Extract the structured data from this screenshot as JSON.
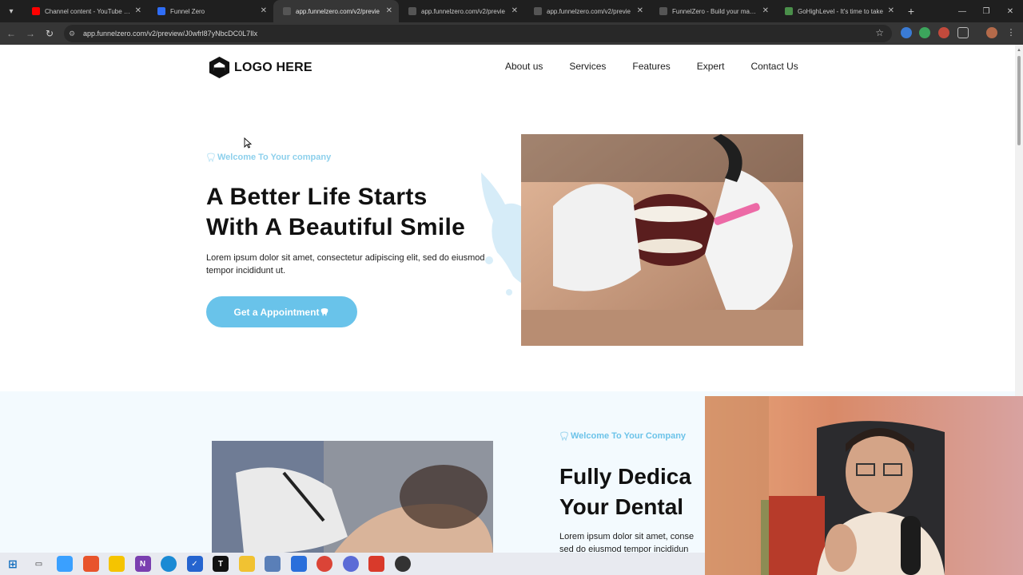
{
  "browser": {
    "tabs": [
      {
        "label": "Channel content - YouTube Stu",
        "favicon_color": "#ff0000"
      },
      {
        "label": "Funnel Zero",
        "favicon_color": "#2f6df6"
      },
      {
        "label": "app.funnelzero.com/v2/previe",
        "favicon_color": "#555555"
      },
      {
        "label": "app.funnelzero.com/v2/previe",
        "favicon_color": "#555555"
      },
      {
        "label": "app.funnelzero.com/v2/previe",
        "favicon_color": "#555555"
      },
      {
        "label": "FunnelZero - Build your marke",
        "favicon_color": "#555555"
      },
      {
        "label": "GoHighLevel - It's time to take",
        "favicon_color": "#4a8f4a"
      }
    ],
    "active_tab_index": 2,
    "url": "app.funnelzero.com/v2/preview/J0wfrl87yNbcDC0L7Ilx"
  },
  "page": {
    "logo_text": "LOGO HERE",
    "nav": [
      "About us",
      "Services",
      "Features",
      "Expert",
      "Contact Us"
    ],
    "hero": {
      "eyebrow": "Welcome To Your company",
      "headline_line1": "A Better Life Starts",
      "headline_line2": "With A Beautiful Smile",
      "lead": "Lorem ipsum dolor sit amet, consectetur adipiscing elit, sed do eiusmod tempor incididunt ut.",
      "cta": "Get a Appointment"
    },
    "section2": {
      "eyebrow": "Welcome To Your Company",
      "headline_line1": "Fully Dedica",
      "headline_line2": "Your Dental",
      "lead_line1": "Lorem ipsum dolor sit amet, conse",
      "lead_line2": "sed do eiusmod tempor incididun"
    }
  },
  "colors": {
    "accent": "#69c3ea",
    "eyebrow": "#8dd0ec",
    "section2_bg": "#f3fafe"
  },
  "taskbar": {
    "icons": [
      "windows-start-icon",
      "task-view-icon",
      "copilot-icon",
      "office-icon",
      "sticky-notes-icon",
      "onenote-icon",
      "edge-icon",
      "todo-icon",
      "tradingview-icon",
      "file-explorer-icon",
      "calculator-icon",
      "windows-app-icon",
      "chrome-icon",
      "chrome-beta-icon",
      "camtasia-icon",
      "obs-icon"
    ]
  }
}
